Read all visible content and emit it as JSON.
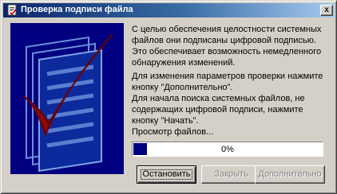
{
  "window": {
    "title": "Проверка подписи файла",
    "close_glyph": "x"
  },
  "message": {
    "paragraph1": "С целью обеспечения целостности системных файлов они подписаны цифровой подписью. Это обеспечивает возможность немедленного обнаружения изменений.",
    "paragraph2": "Для изменения параметров проверки нажмите кнопку \"Дополнительно\".\nДля начала поиска системных файлов, не содержащих цифровой подписи, нажмите кнопку \"Начать\"."
  },
  "status": {
    "text": "Просмотр файлов..."
  },
  "progress": {
    "percent_label": "0%",
    "fill_fraction": 0.07
  },
  "buttons": {
    "stop": "Остановить",
    "close": "Закрыть",
    "advanced": "Дополнительно"
  },
  "colors": {
    "titlebar_start": "#0a246a",
    "titlebar_end": "#a6caf0",
    "art_background": "#000080",
    "checkmark": "#8b0a0a",
    "progress_fill": "#000080"
  }
}
